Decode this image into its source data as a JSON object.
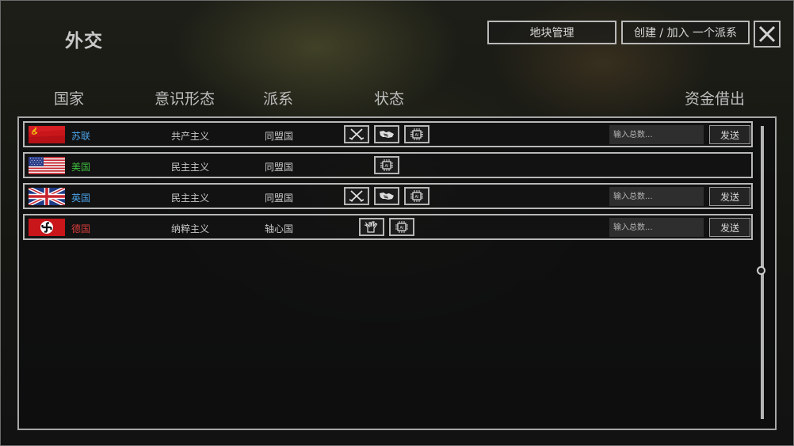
{
  "header": {
    "title": "外交",
    "tiles_button": "地块管理",
    "faction_button": "创建 / 加入 一个派系",
    "close_icon": "close-icon"
  },
  "columns": {
    "country": "国家",
    "ideology": "意识形态",
    "faction": "派系",
    "status": "状态",
    "loan": "资金借出"
  },
  "colors": {
    "ussr": "#4aa3e8",
    "usa": "#3fbf3f",
    "uk": "#4aa3e8",
    "germany": "#d83c3c"
  },
  "rows": [
    {
      "country": "苏联",
      "ideology": "共产主义",
      "faction": "同盟国",
      "flag": "soviet-flag",
      "status_icons": [
        "crossed-swords-icon",
        "handshake-icon",
        "ai-chip-icon"
      ],
      "amount_placeholder": "输入总数...",
      "send_label": "发送"
    },
    {
      "country": "美国",
      "ideology": "民主主义",
      "faction": "同盟国",
      "flag": "usa-flag",
      "status_icons": [
        "ai-chip-icon"
      ]
    },
    {
      "country": "英国",
      "ideology": "民主主义",
      "faction": "同盟国",
      "flag": "uk-flag",
      "status_icons": [
        "crossed-swords-icon",
        "handshake-icon",
        "ai-chip-icon"
      ],
      "amount_placeholder": "输入总数...",
      "send_label": "发送"
    },
    {
      "country": "德国",
      "ideology": "纳粹主义",
      "faction": "轴心国",
      "flag": "germany-flag",
      "status_icons": [
        "peace-hand-icon",
        "ai-chip-icon"
      ],
      "amount_placeholder": "输入总数...",
      "send_label": "发送"
    }
  ]
}
